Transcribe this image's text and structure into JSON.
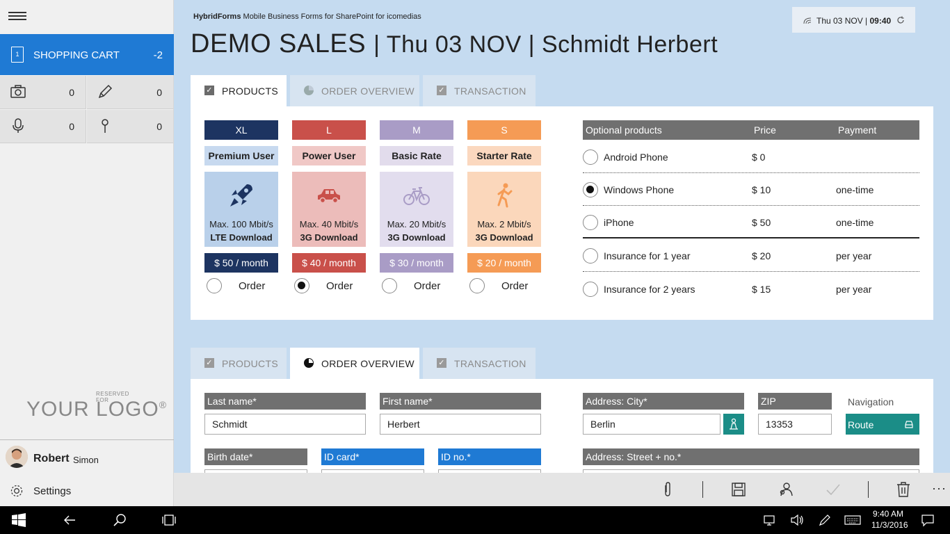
{
  "sidebar": {
    "cart_label": "SHOPPING CART",
    "cart_count": "-2",
    "cart_icon_text": "1",
    "camera_count": "0",
    "pen_count": "0",
    "mic_count": "0",
    "pin_count": "0",
    "logo_reserved": "RESERVED FOR",
    "logo_text": "YOUR LOGO",
    "logo_reg": "®",
    "user_first": "Robert",
    "user_last": "Simon",
    "settings": "Settings"
  },
  "header": {
    "brand_bold": "HybridForms",
    "brand_rest": "Mobile Business Forms for SharePoint for icomedias",
    "title": "DEMO SALES",
    "title_rest": "| Thu 03 NOV | Schmidt Herbert",
    "clock_date": "Thu 03 NOV |",
    "clock_time": "09:40"
  },
  "tabs": {
    "products": "PRODUCTS",
    "overview": "ORDER OVERVIEW",
    "transaction": "TRANSACTION"
  },
  "plans": [
    {
      "size": "XL",
      "name": "Premium User",
      "speed": "Max. 100 Mbit/s",
      "download": "LTE Download",
      "price": "$ 50 / month",
      "order": "Order",
      "selected": false,
      "icon": "rocket-icon",
      "color": "#1d3461",
      "light": "#c7d9ef",
      "card": "#b9d0ea"
    },
    {
      "size": "L",
      "name": "Power User",
      "speed": "Max. 40 Mbit/s",
      "download": "3G Download",
      "price": "$ 40 / month",
      "order": "Order",
      "selected": true,
      "icon": "car-icon",
      "color": "#c9504a",
      "light": "#f0c8c6",
      "card": "#ecbcba"
    },
    {
      "size": "M",
      "name": "Basic Rate",
      "speed": "Max. 20 Mbit/s",
      "download": "3G Download",
      "price": "$ 30 / month",
      "order": "Order",
      "selected": false,
      "icon": "bicycle-icon",
      "color": "#a99cc6",
      "light": "#e2dcec",
      "card": "#e2ddee"
    },
    {
      "size": "S",
      "name": "Starter Rate",
      "speed": "Max. 2 Mbit/s",
      "download": "3G Download",
      "price": "$ 20 / month",
      "order": "Order",
      "selected": false,
      "icon": "walker-icon",
      "color": "#f59b55",
      "light": "#fbd8bf",
      "card": "#fbd7bb"
    }
  ],
  "optional": {
    "headers": [
      "Optional products",
      "Price",
      "Payment"
    ],
    "rows": [
      {
        "name": "Android Phone",
        "price": "$ 0",
        "payment": "",
        "selected": false
      },
      {
        "name": "Windows Phone",
        "price": "$ 10",
        "payment": "one-time",
        "selected": true
      },
      {
        "name": "iPhone",
        "price": "$ 50",
        "payment": "one-time",
        "selected": false
      },
      {
        "name": "Insurance for 1 year",
        "price": "$ 20",
        "payment": "per year",
        "selected": false
      },
      {
        "name": "Insurance for 2 years",
        "price": "$ 15",
        "payment": "per year",
        "selected": false
      }
    ]
  },
  "form": {
    "last_name_label": "Last name",
    "last_name_value": "Schmidt",
    "first_name_label": "First name",
    "first_name_value": "Herbert",
    "city_label": "Address: City",
    "city_value": "Berlin",
    "zip_label": "ZIP",
    "zip_value": "13353",
    "nav_label": "Navigation",
    "route_button": "Route",
    "birth_label": "Birth date",
    "idcard_label": "ID card",
    "idno_label": "ID no.",
    "street_label": "Address: Street + no.",
    "required_mark": "*"
  },
  "taskbar": {
    "time": "9:40 AM",
    "date": "11/3/2016"
  },
  "colors": {
    "accent": "#1f7ad4",
    "teal": "#1b8d87",
    "background": "#c5dbf0"
  }
}
